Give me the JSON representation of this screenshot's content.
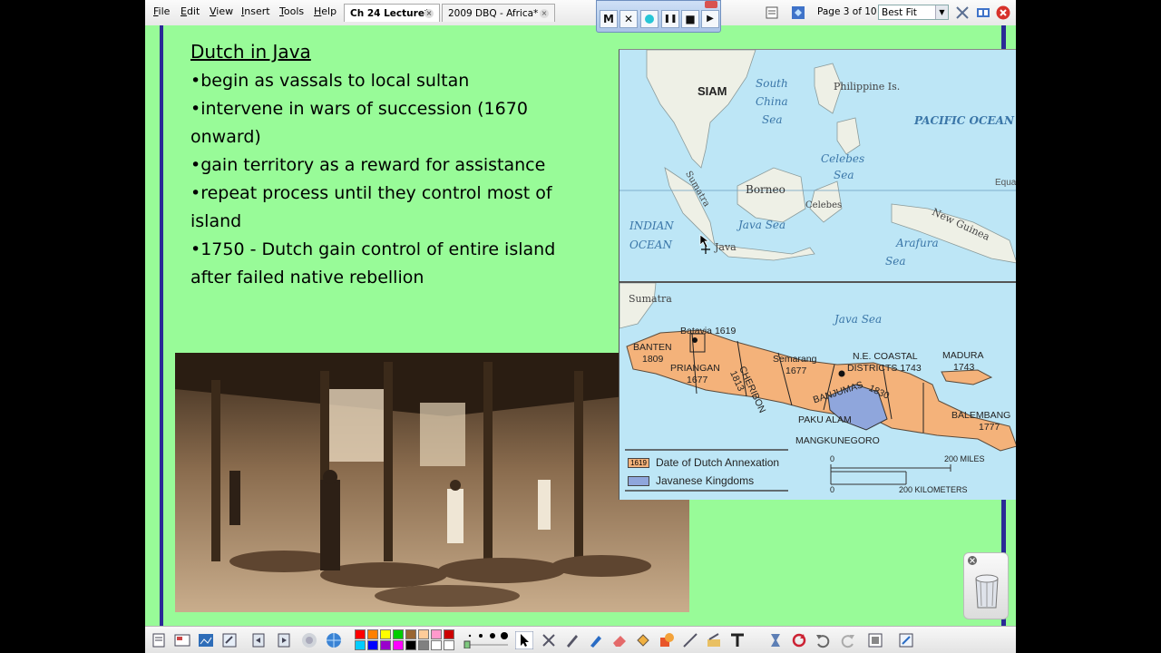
{
  "menu": [
    "File",
    "Edit",
    "View",
    "Insert",
    "Tools",
    "Help"
  ],
  "tabs": [
    {
      "label": "Ch 24 Lecture*",
      "active": true
    },
    {
      "label": "2009 DBQ - Africa*",
      "active": false
    }
  ],
  "recorder": {
    "menu_label": "M",
    "close_label": "✕",
    "pause_label": "❚❚",
    "stop_label": "■",
    "play_label": "▶"
  },
  "page_info": "Page 3 of 10",
  "zoom": {
    "selected": "Best Fit"
  },
  "slide": {
    "title": "Dutch in Java",
    "bullets": [
      "begin as vassals to local sultan",
      "intervene in wars of succession (1670 onward)",
      "gain territory as a reward for assistance",
      "repeat process until they control most of island",
      "1750 - Dutch gain control of entire island after failed native rebellion"
    ]
  },
  "map_top": {
    "labels": [
      "SIAM",
      "South",
      "China",
      "Sea",
      "Philippine Is.",
      "PACIFIC OCEAN",
      "Celebes",
      "Sea",
      "Borneo",
      "Sumatra",
      "Celebes",
      "INDIAN",
      "OCEAN",
      "Java Sea",
      "Java",
      "Arafura",
      "Sea",
      "New Guinea",
      "Equa"
    ]
  },
  "map_java": {
    "labels": {
      "sumatra": "Sumatra",
      "java_sea": "Java Sea",
      "batavia": "Batavia 1619",
      "banten": "BANTEN",
      "banten_year": "1809",
      "priangan": "PRIANGAN",
      "priangan_year": "1677",
      "cheribon": "CHERIBON",
      "cheribon_year": "1813",
      "semarang": "Semarang",
      "semarang_year": "1677",
      "ne_coastal": "N.E. COASTAL",
      "districts": "DISTRICTS 1743",
      "madura": "MADURA",
      "madura_year": "1743",
      "banjumas": "BANJUMAS",
      "banjumas_year": "1830",
      "paku_alam": "PAKU ALAM",
      "mangkunegoro": "MANGKUNEGORO",
      "balembang": "BALEMBANG",
      "balembang_year": "1777"
    },
    "legend": [
      {
        "swatch_text": "1619",
        "label": "Date of Dutch Annexation",
        "color": "#f4b27a"
      },
      {
        "swatch_text": "",
        "label": "Javanese Kingdoms",
        "color": "#8fa6dc"
      }
    ],
    "scale": {
      "zero_top": "0",
      "miles": "200 MILES",
      "zero_bottom": "0",
      "km": "200 KILOMETERS"
    }
  },
  "colors": {
    "slide_bg": "#98fb98",
    "accent_bar": "#2a2a96",
    "land_annexed": "#f4b27a",
    "kingdoms": "#8fa6dc",
    "sea": "#bde6f6"
  },
  "palette": [
    "#ff0000",
    "#ff8000",
    "#ffff00",
    "#00cc00",
    "#00cc66",
    "#996633",
    "#ffcc99",
    "#ff99cc",
    "#cc0000",
    "#00ccff",
    "#0000ff",
    "#9900cc",
    "#ff00ff",
    "#000000",
    "#808080",
    "#ffffff"
  ],
  "icons": [
    "pages-icon",
    "properties-icon",
    "gallery-icon",
    "attachments-icon",
    "prev-page-icon",
    "next-page-icon",
    "record-icon",
    "globe-icon",
    "select-icon",
    "tools-icon",
    "pen-icon",
    "highlighter-icon",
    "eraser-icon",
    "fill-icon",
    "shapes-icon",
    "creative-pen-icon",
    "text-icon",
    "screen-shade-icon",
    "refresh-icon",
    "undo-icon",
    "redo-icon",
    "capture-icon",
    "toolbar-toggle-icon"
  ]
}
